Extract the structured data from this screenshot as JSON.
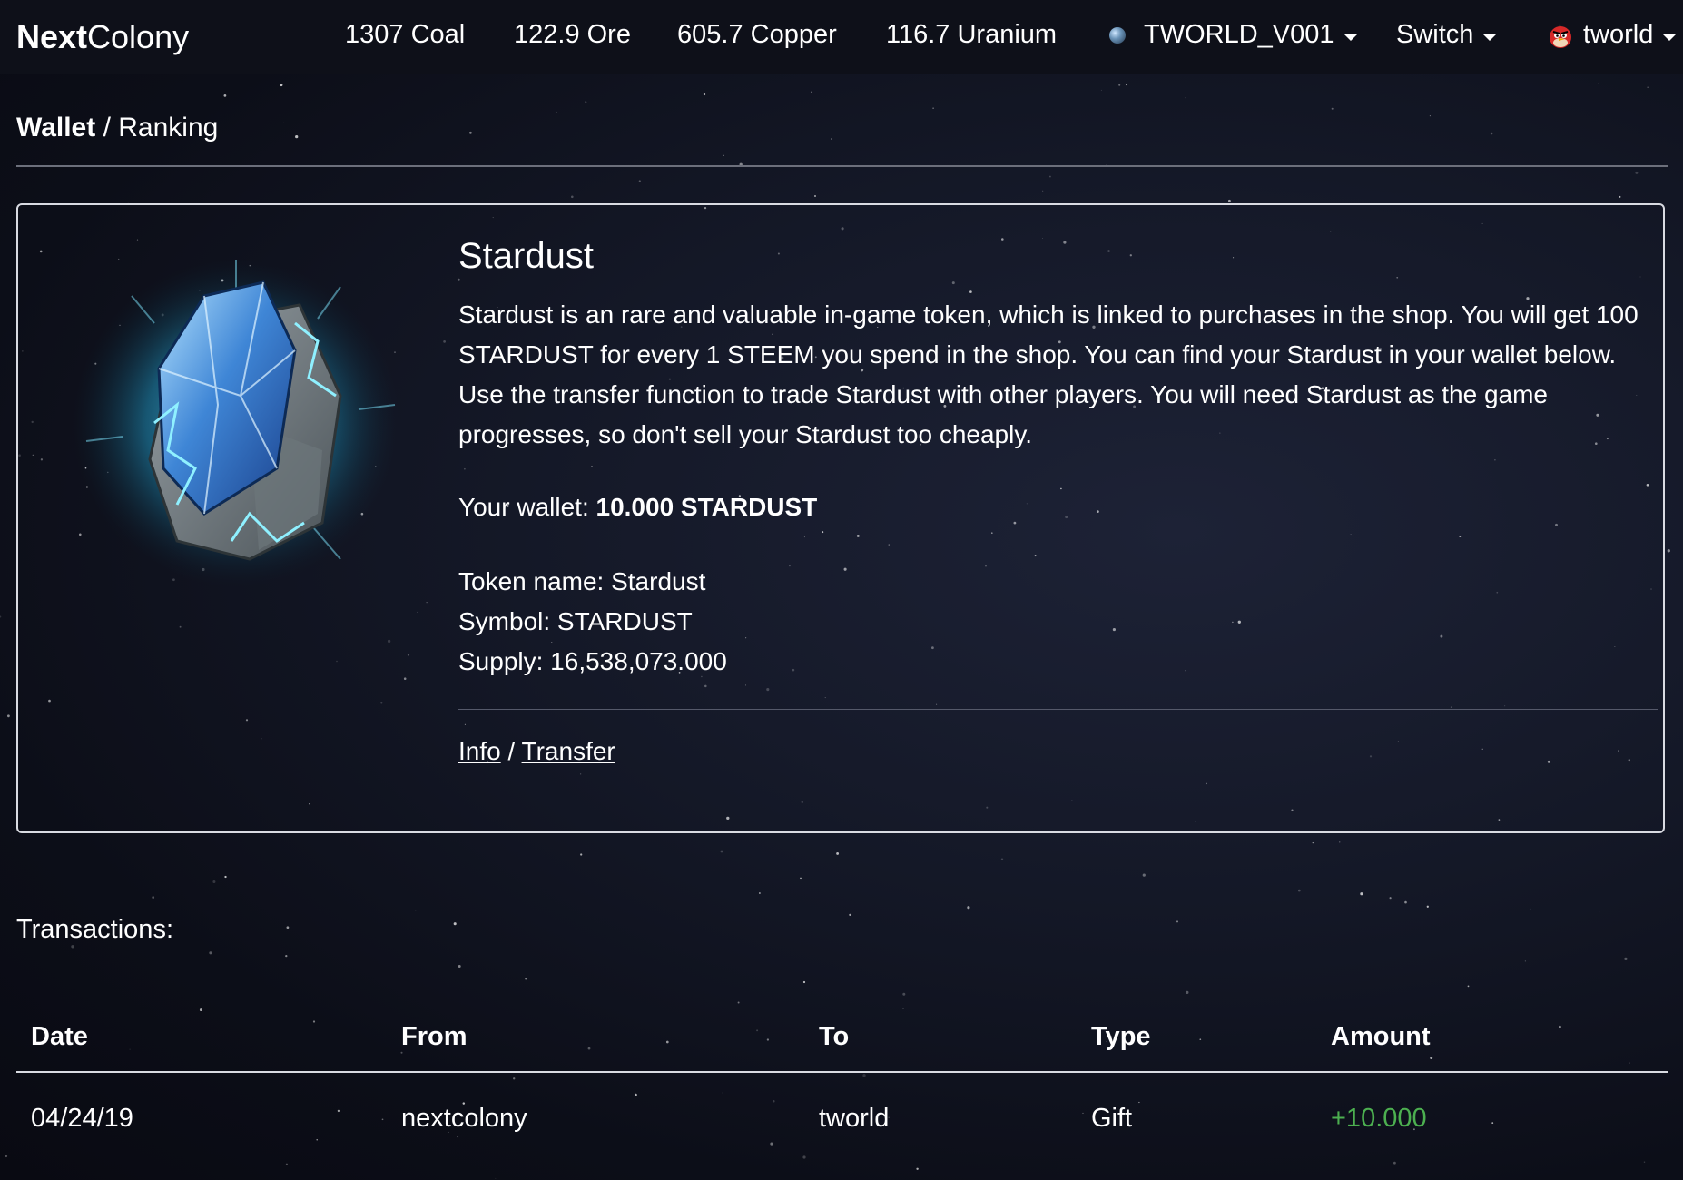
{
  "navbar": {
    "brand_bold": "Next",
    "brand_rest": "Colony",
    "resources": {
      "coal": "1307 Coal",
      "ore": "122.9 Ore",
      "copper": "605.7 Copper",
      "uranium": "116.7 Uranium"
    },
    "planet_selector": "TWORLD_V001",
    "switch_label": "Switch",
    "user_name": "tworld"
  },
  "breadcrumb": {
    "current": "Wallet",
    "separator": " / ",
    "link": "Ranking"
  },
  "token_card": {
    "title": "Stardust",
    "description": "Stardust is an rare and valuable in-game token, which is linked to purchases in the shop. You will get 100 STARDUST for every 1 STEEM you spend in the shop. You can find your Stardust in your wallet below. Use the transfer function to trade Stardust with other players. You will need Stardust as the game progresses, so don't sell your Stardust too cheaply.",
    "wallet_label": "Your wallet: ",
    "wallet_value": "10.000 STARDUST",
    "token_name": "Token name: Stardust",
    "symbol": "Symbol: STARDUST",
    "supply": "Supply: 16,538,073.000",
    "info_link": "Info",
    "link_separator": " / ",
    "transfer_link": "Transfer"
  },
  "transactions": {
    "title": "Transactions:",
    "columns": [
      "Date",
      "From",
      "To",
      "Type",
      "Amount"
    ],
    "rows": [
      {
        "date": "04/24/19",
        "from": "nextcolony",
        "to": "tworld",
        "type": "Gift",
        "amount": "+10.000"
      }
    ]
  },
  "colors": {
    "background": "#0c0e18",
    "positive_amount": "#4caf50",
    "border": "#d9dbe2"
  },
  "icons": {
    "planet": "planet-icon",
    "user_avatar": "angry-bird-icon",
    "token": "stardust-crystal-icon"
  }
}
